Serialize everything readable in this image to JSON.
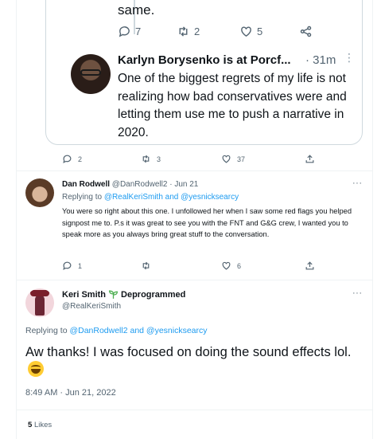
{
  "thread_top": {
    "continuation_text": "same.",
    "actions": {
      "reply_count": "7",
      "retweet_count": "2",
      "like_count": "5"
    }
  },
  "quoted_tweet": {
    "author_name": "Karlyn Borysenko is at Porcf...",
    "time": "· 31m",
    "text": "One of the biggest regrets of my life is not realizing how bad conservatives were and letting them use me to push a narrative in 2020."
  },
  "parent_actions": {
    "reply_count": "2",
    "retweet_count": "3",
    "like_count": "37"
  },
  "reply_tweet": {
    "author_name": "Dan Rodwell",
    "handle": "@DanRodwell2",
    "date": "· Jun 21",
    "replying_prefix": "Replying to",
    "replying_mentions": "@RealKeriSmith and @yesnicksearcy",
    "text": "You were so right about this one. I unfollowed her when I saw some red flags you helped signpost me to. P.s it was great to see you with the FNT and G&G crew, I wanted you to speak more as you always bring great stuff to the conversation.",
    "actions": {
      "reply_count": "1",
      "retweet_count": "",
      "like_count": "6"
    }
  },
  "main_tweet": {
    "author_name": "Keri Smith",
    "author_suffix": "Deprogrammed",
    "handle": "@RealKeriSmith",
    "replying_prefix": "Replying to",
    "replying_mentions": "@DanRodwell2 and @yesnicksearcy",
    "text": "Aw thanks! I was focused on doing the sound effects lol.",
    "timestamp": "8:49 AM · Jun 21, 2022",
    "likes_count": "5",
    "likes_label": "Likes"
  },
  "icons": [
    "reply-icon",
    "retweet-icon",
    "like-icon",
    "share-icon",
    "more-icon",
    "sprout-icon",
    "grin-emoji-icon"
  ],
  "colors": {
    "link": "#1d9bf0",
    "secondary_text": "#536471",
    "border": "#cfd9de",
    "sprout": "#4caf50"
  }
}
